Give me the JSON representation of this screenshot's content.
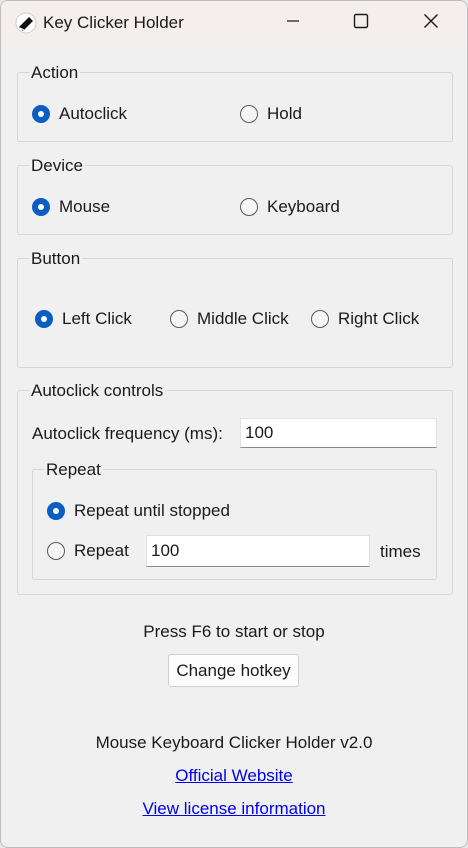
{
  "window": {
    "title": "Key Clicker Holder",
    "icons": [
      "app-icon",
      "minimize-icon",
      "maximize-icon",
      "close-icon"
    ]
  },
  "action": {
    "legend": "Action",
    "options": [
      {
        "label": "Autoclick",
        "checked": true
      },
      {
        "label": "Hold",
        "checked": false
      }
    ]
  },
  "device": {
    "legend": "Device",
    "options": [
      {
        "label": "Mouse",
        "checked": true
      },
      {
        "label": "Keyboard",
        "checked": false
      }
    ]
  },
  "button": {
    "legend": "Button",
    "options": [
      {
        "label": "Left Click",
        "checked": true
      },
      {
        "label": "Middle Click",
        "checked": false
      },
      {
        "label": "Right Click",
        "checked": false
      }
    ]
  },
  "autoclick": {
    "legend": "Autoclick controls",
    "frequency_label": "Autoclick frequency (ms):",
    "frequency_value": "100",
    "repeat": {
      "legend": "Repeat",
      "until_stopped_label": "Repeat until stopped",
      "until_stopped_checked": true,
      "count_label": "Repeat",
      "count_checked": false,
      "count_value": "100",
      "count_suffix": "times"
    }
  },
  "hotkey": {
    "hint": "Press F6 to start or stop",
    "change_label": "Change hotkey"
  },
  "footer": {
    "version": "Mouse Keyboard Clicker Holder v2.0",
    "website_link": "Official Website",
    "license_link": "View license information"
  },
  "colors": {
    "accent": "#0a5ec2",
    "link": "#0000ee",
    "titlebar": "#f5eeee",
    "background": "#f0f0f0"
  }
}
